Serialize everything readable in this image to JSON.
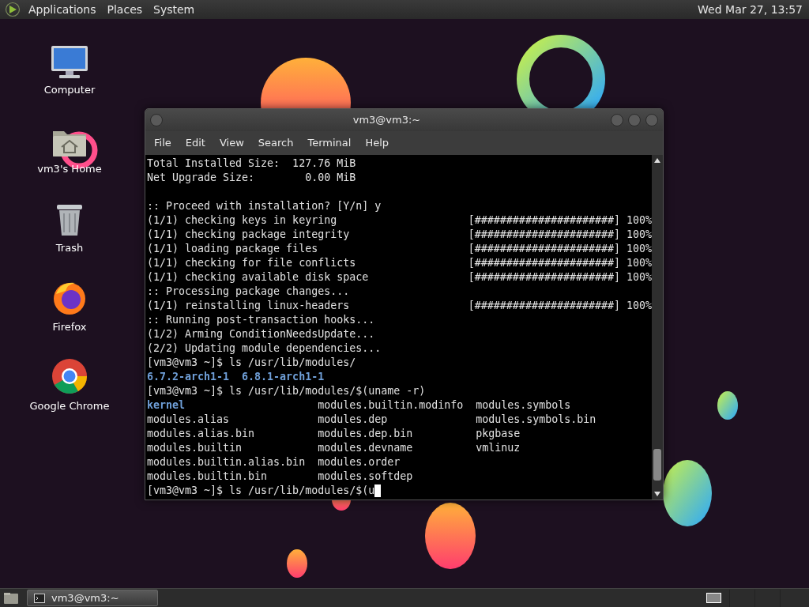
{
  "top_panel": {
    "menus": [
      "Applications",
      "Places",
      "System"
    ],
    "clock": "Wed Mar 27, 13:57"
  },
  "desktop_icons": [
    {
      "label": "Computer",
      "kind": "computer"
    },
    {
      "label": "vm3's Home",
      "kind": "home"
    },
    {
      "label": "Trash",
      "kind": "trash"
    },
    {
      "label": "Firefox",
      "kind": "firefox"
    },
    {
      "label": "Google Chrome",
      "kind": "chrome"
    }
  ],
  "window": {
    "title": "vm3@vm3:~",
    "menu": [
      "File",
      "Edit",
      "View",
      "Search",
      "Terminal",
      "Help"
    ],
    "lines": [
      {
        "kind": "text",
        "text": "Total Installed Size:  127.76 MiB"
      },
      {
        "kind": "text",
        "text": "Net Upgrade Size:        0.00 MiB"
      },
      {
        "kind": "blank"
      },
      {
        "kind": "text",
        "text": ":: Proceed with installation? [Y/n] y"
      },
      {
        "kind": "progress",
        "text": "(1/1) checking keys in keyring",
        "bar": "[######################]",
        "percent": "100%"
      },
      {
        "kind": "progress",
        "text": "(1/1) checking package integrity",
        "bar": "[######################]",
        "percent": "100%"
      },
      {
        "kind": "progress",
        "text": "(1/1) loading package files",
        "bar": "[######################]",
        "percent": "100%"
      },
      {
        "kind": "progress",
        "text": "(1/1) checking for file conflicts",
        "bar": "[######################]",
        "percent": "100%"
      },
      {
        "kind": "progress",
        "text": "(1/1) checking available disk space",
        "bar": "[######################]",
        "percent": "100%"
      },
      {
        "kind": "text",
        "text": ":: Processing package changes..."
      },
      {
        "kind": "progress",
        "text": "(1/1) reinstalling linux-headers",
        "bar": "[######################]",
        "percent": "100%"
      },
      {
        "kind": "text",
        "text": ":: Running post-transaction hooks..."
      },
      {
        "kind": "text",
        "text": "(1/2) Arming ConditionNeedsUpdate..."
      },
      {
        "kind": "text",
        "text": "(2/2) Updating module dependencies..."
      },
      {
        "kind": "text",
        "text": "[vm3@vm3 ~]$ ls /usr/lib/modules/"
      },
      {
        "kind": "directory",
        "text": "6.7.2-arch1-1  6.8.1-arch1-1"
      },
      {
        "kind": "text",
        "text": "[vm3@vm3 ~]$ ls /usr/lib/modules/$(uname -r)"
      },
      {
        "kind": "listing",
        "cells": [
          {
            "text": "kernel",
            "directory": true
          },
          {
            "text": "modules.builtin.modinfo",
            "directory": false
          },
          {
            "text": "modules.symbols",
            "directory": false
          }
        ]
      },
      {
        "kind": "listing",
        "cells": [
          {
            "text": "modules.alias",
            "directory": false
          },
          {
            "text": "modules.dep",
            "directory": false
          },
          {
            "text": "modules.symbols.bin",
            "directory": false
          }
        ]
      },
      {
        "kind": "listing",
        "cells": [
          {
            "text": "modules.alias.bin",
            "directory": false
          },
          {
            "text": "modules.dep.bin",
            "directory": false
          },
          {
            "text": "pkgbase",
            "directory": false
          }
        ]
      },
      {
        "kind": "listing",
        "cells": [
          {
            "text": "modules.builtin",
            "directory": false
          },
          {
            "text": "modules.devname",
            "directory": false
          },
          {
            "text": "vmlinuz",
            "directory": false
          }
        ]
      },
      {
        "kind": "listing",
        "cells": [
          {
            "text": "modules.builtin.alias.bin",
            "directory": false
          },
          {
            "text": "modules.order",
            "directory": false
          }
        ]
      },
      {
        "kind": "listing",
        "cells": [
          {
            "text": "modules.builtin.bin",
            "directory": false
          },
          {
            "text": "modules.softdep",
            "directory": false
          }
        ]
      },
      {
        "kind": "prompt",
        "text": "[vm3@vm3 ~]$ ls /usr/lib/modules/$(u"
      }
    ]
  },
  "taskbar": {
    "tasks": [
      {
        "label": "vm3@vm3:~",
        "selected": true
      }
    ]
  }
}
